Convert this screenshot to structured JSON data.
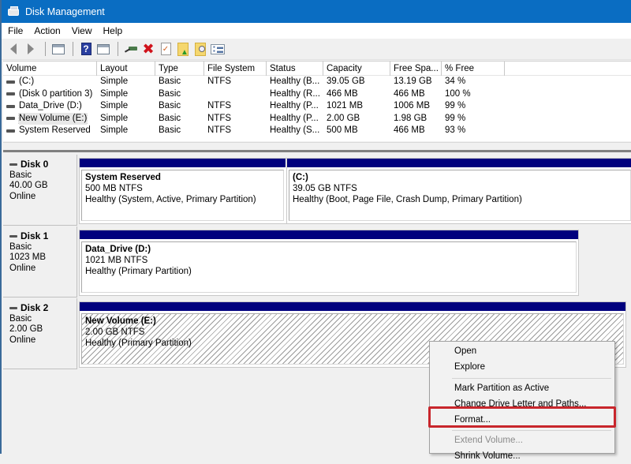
{
  "window": {
    "title": "Disk Management"
  },
  "menubar": {
    "items": [
      "File",
      "Action",
      "View",
      "Help"
    ]
  },
  "toolbar": {
    "buttons": [
      {
        "name": "back-button",
        "icon": "arrow-left-icon"
      },
      {
        "name": "forward-button",
        "icon": "arrow-right-icon"
      },
      {
        "name": "show-hide-console-tree-button",
        "icon": "console-panel-icon"
      },
      {
        "name": "help-button",
        "icon": "help-icon"
      },
      {
        "name": "show-hide-action-pane-button",
        "icon": "action-panel-icon"
      },
      {
        "name": "connect-virtual-disk-button",
        "icon": "connect-drive-icon"
      },
      {
        "name": "delete-button",
        "icon": "delete-x-icon"
      },
      {
        "name": "check-button",
        "icon": "checklist-icon"
      },
      {
        "name": "open-button",
        "icon": "folder-up-icon"
      },
      {
        "name": "explore-button",
        "icon": "folder-search-icon"
      },
      {
        "name": "properties-button",
        "icon": "properties-icon"
      }
    ]
  },
  "volume_list": {
    "columns": [
      "Volume",
      "Layout",
      "Type",
      "File System",
      "Status",
      "Capacity",
      "Free Spa...",
      "% Free"
    ],
    "rows": [
      {
        "volume": " (C:)",
        "layout": "Simple",
        "type": "Basic",
        "fs": "NTFS",
        "status": "Healthy (B...",
        "capacity": "39.05 GB",
        "free": "13.19 GB",
        "pct": "34 %"
      },
      {
        "volume": "(Disk 0 partition 3)",
        "layout": "Simple",
        "type": "Basic",
        "fs": "",
        "status": "Healthy (R...",
        "capacity": "466 MB",
        "free": "466 MB",
        "pct": "100 %"
      },
      {
        "volume": "Data_Drive (D:)",
        "layout": "Simple",
        "type": "Basic",
        "fs": "NTFS",
        "status": "Healthy (P...",
        "capacity": "1021 MB",
        "free": "1006 MB",
        "pct": "99 %"
      },
      {
        "volume": "New Volume (E:)",
        "layout": "Simple",
        "type": "Basic",
        "fs": "NTFS",
        "status": "Healthy (P...",
        "capacity": "2.00 GB",
        "free": "1.98 GB",
        "pct": "99 %"
      },
      {
        "volume": "System Reserved",
        "layout": "Simple",
        "type": "Basic",
        "fs": "NTFS",
        "status": "Healthy (S...",
        "capacity": "500 MB",
        "free": "466 MB",
        "pct": "93 %"
      }
    ],
    "selected_row": 3
  },
  "disks": [
    {
      "name": "Disk 0",
      "type": "Basic",
      "size": "40.00 GB",
      "state": "Online",
      "partitions": [
        {
          "name": "System Reserved",
          "size_fs": "500 MB NTFS",
          "status": "Healthy (System, Active, Primary Partition)"
        },
        {
          "name": " (C:)",
          "size_fs": "39.05 GB NTFS",
          "status": "Healthy (Boot, Page File, Crash Dump, Primary Partition)"
        }
      ]
    },
    {
      "name": "Disk 1",
      "type": "Basic",
      "size": "1023 MB",
      "state": "Online",
      "partitions": [
        {
          "name": "Data_Drive  (D:)",
          "size_fs": "1021 MB NTFS",
          "status": "Healthy (Primary Partition)"
        }
      ]
    },
    {
      "name": "Disk 2",
      "type": "Basic",
      "size": "2.00 GB",
      "state": "Online",
      "partitions": [
        {
          "name": "New Volume  (E:)",
          "size_fs": "2.00 GB NTFS",
          "status": "Healthy (Primary Partition)",
          "selected": true
        }
      ]
    }
  ],
  "context_menu": {
    "items": [
      {
        "label": "Open",
        "enabled": true
      },
      {
        "label": "Explore",
        "enabled": true
      },
      {
        "separator": true
      },
      {
        "label": "Mark Partition as Active",
        "enabled": true
      },
      {
        "label": "Change Drive Letter and Paths...",
        "enabled": true
      },
      {
        "label": "Format...",
        "enabled": true,
        "highlighted": true
      },
      {
        "separator": true
      },
      {
        "label": "Extend Volume...",
        "enabled": false
      },
      {
        "label": "Shrink Volume...",
        "enabled": true
      }
    ],
    "highlight_color": "#c8262c"
  }
}
